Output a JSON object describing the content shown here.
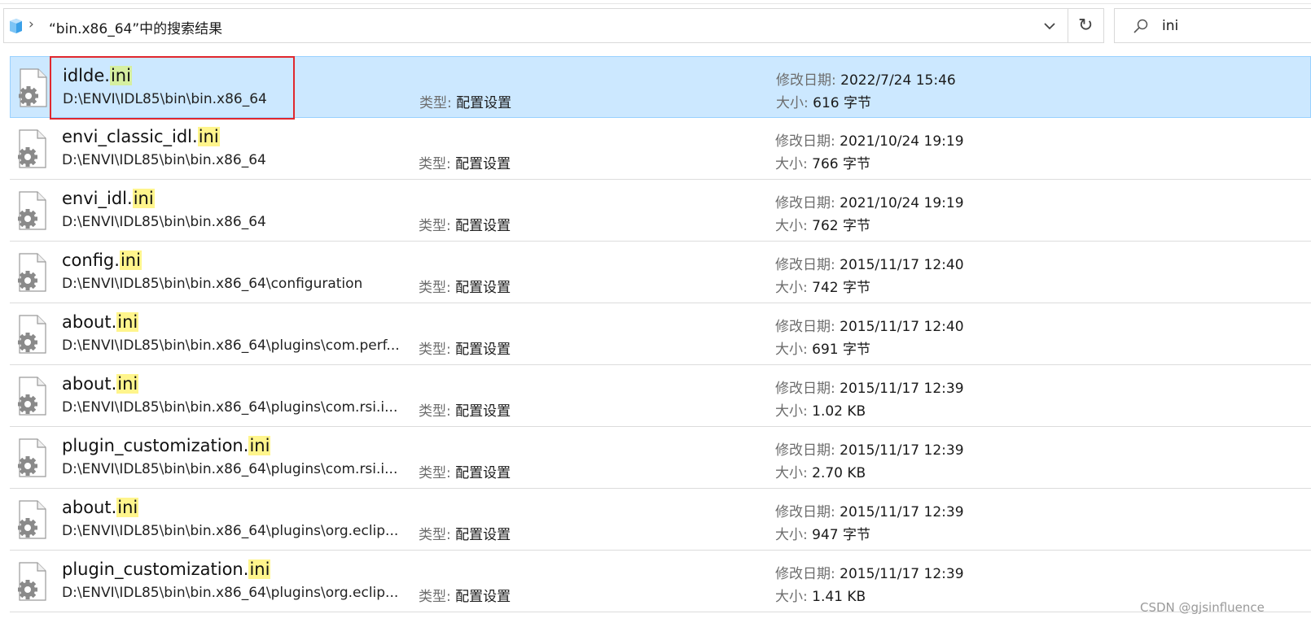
{
  "address_bar": {
    "location": "“bin.x86_64”中的搜索结果"
  },
  "search": {
    "value": "ini"
  },
  "labels": {
    "type": "类型:",
    "date": "修改日期:",
    "size": "大小:"
  },
  "results": [
    {
      "name": "idlde",
      "ext": "ini",
      "path": "D:\\ENVI\\IDL85\\bin\\bin.x86_64",
      "type": "配置设置",
      "date": "2022/7/24 15:46",
      "size": "616 字节",
      "selected": true
    },
    {
      "name": "envi_classic_idl",
      "ext": "ini",
      "path": "D:\\ENVI\\IDL85\\bin\\bin.x86_64",
      "type": "配置设置",
      "date": "2021/10/24 19:19",
      "size": "766 字节"
    },
    {
      "name": "envi_idl",
      "ext": "ini",
      "path": "D:\\ENVI\\IDL85\\bin\\bin.x86_64",
      "type": "配置设置",
      "date": "2021/10/24 19:19",
      "size": "762 字节"
    },
    {
      "name": "config",
      "ext": "ini",
      "path": "D:\\ENVI\\IDL85\\bin\\bin.x86_64\\configuration",
      "type": "配置设置",
      "date": "2015/11/17 12:40",
      "size": "742 字节"
    },
    {
      "name": "about",
      "ext": "ini",
      "path": "D:\\ENVI\\IDL85\\bin\\bin.x86_64\\plugins\\com.perf...",
      "type": "配置设置",
      "date": "2015/11/17 12:40",
      "size": "691 字节"
    },
    {
      "name": "about",
      "ext": "ini",
      "path": "D:\\ENVI\\IDL85\\bin\\bin.x86_64\\plugins\\com.rsi.i...",
      "type": "配置设置",
      "date": "2015/11/17 12:39",
      "size": "1.02 KB"
    },
    {
      "name": "plugin_customization",
      "ext": "ini",
      "path": "D:\\ENVI\\IDL85\\bin\\bin.x86_64\\plugins\\com.rsi.i...",
      "type": "配置设置",
      "date": "2015/11/17 12:39",
      "size": "2.70 KB"
    },
    {
      "name": "about",
      "ext": "ini",
      "path": "D:\\ENVI\\IDL85\\bin\\bin.x86_64\\plugins\\org.eclip...",
      "type": "配置设置",
      "date": "2015/11/17 12:39",
      "size": "947 字节"
    },
    {
      "name": "plugin_customization",
      "ext": "ini",
      "path": "D:\\ENVI\\IDL85\\bin\\bin.x86_64\\plugins\\org.eclip...",
      "type": "配置设置",
      "date": "2015/11/17 12:39",
      "size": "1.41 KB"
    }
  ],
  "watermark": "CSDN @gjsinfluence",
  "colors": {
    "selection_bg": "#cce8ff",
    "highlight": "#fff58c",
    "annotation_box": "#e0282e"
  },
  "icons": {
    "location": "folder-cube-icon",
    "chevron": "chevron-right-icon",
    "dropdown": "chevron-down-icon",
    "refresh": "refresh-icon",
    "search": "search-icon",
    "file": "settings-file-icon"
  }
}
